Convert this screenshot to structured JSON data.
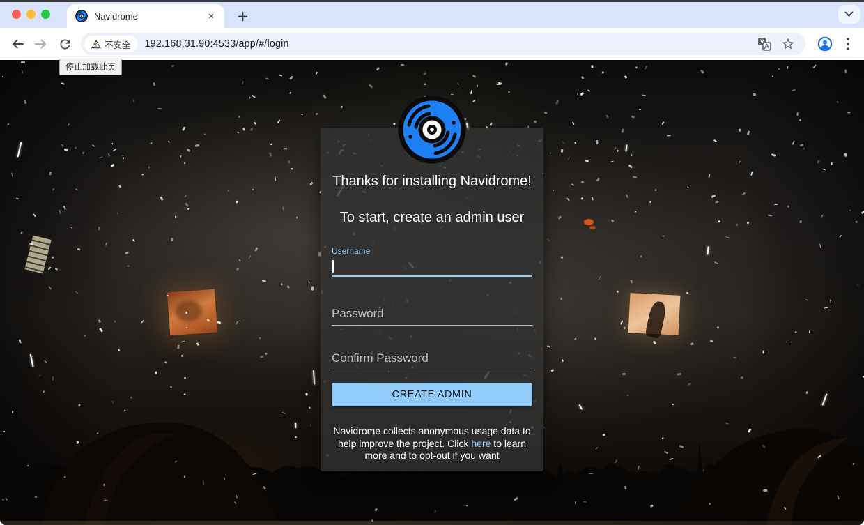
{
  "browser": {
    "tab_title": "Navidrome",
    "tab_close_label": "×",
    "new_tab_label": "+",
    "url": "192.168.31.90:4533/app/#/login",
    "security_label": "不安全",
    "stop_tooltip": "停止加载此页"
  },
  "app": {
    "welcome_line1": "Thanks for installing Navidrome!",
    "welcome_line2": "To start, create an admin user",
    "username_label": "Username",
    "username_value": "",
    "password_label": "Password",
    "confirm_password_label": "Confirm Password",
    "create_admin_label": "CREATE ADMIN",
    "footer_text_before": "Navidrome collects anonymous usage data to help improve the project. Click ",
    "footer_link_label": "here",
    "footer_text_after": " to learn more and to opt-out if you want",
    "colors": {
      "accent": "#90caf9",
      "button_background": "#90caf9",
      "logo_blue": "#1d80f5"
    }
  }
}
